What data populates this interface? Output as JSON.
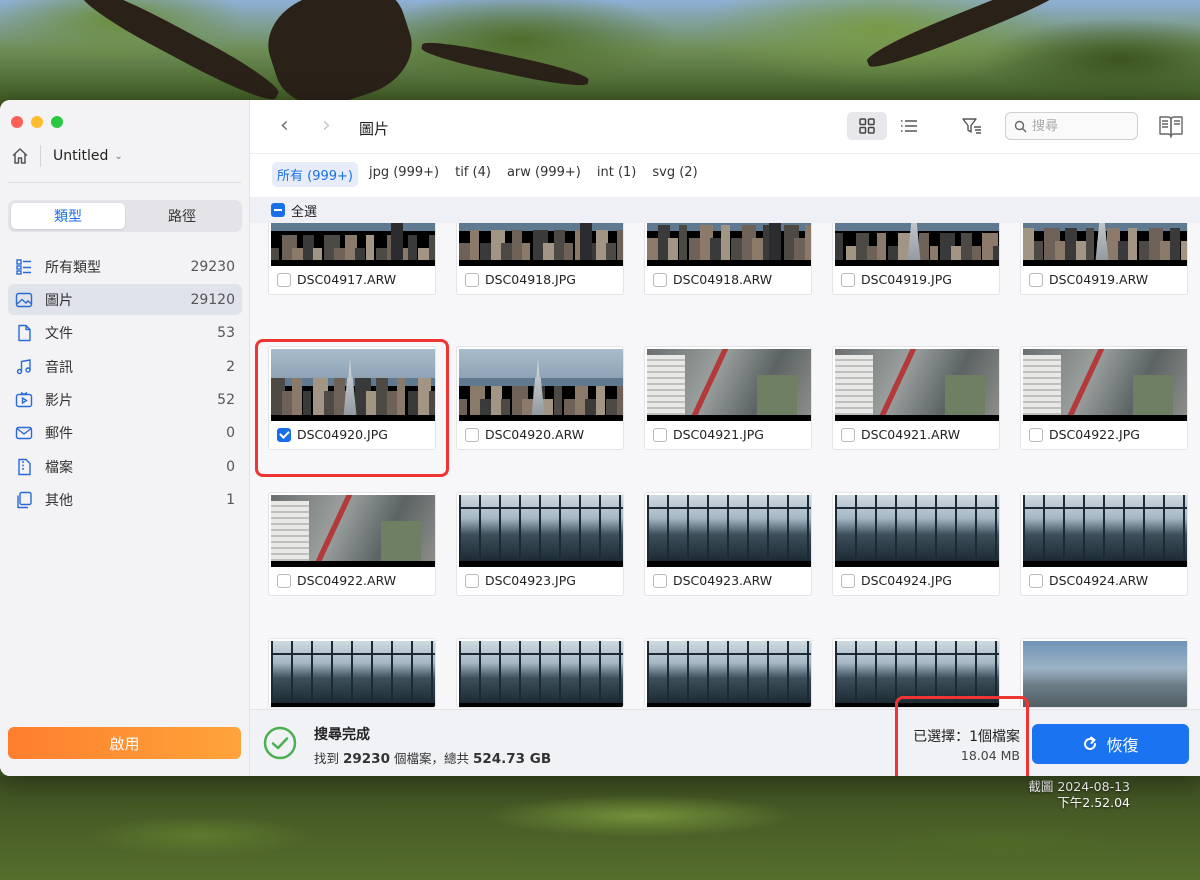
{
  "window": {
    "project_name": "Untitled"
  },
  "sidebar": {
    "tabs": [
      {
        "label": "類型",
        "active": true
      },
      {
        "label": "路徑",
        "active": false
      }
    ],
    "categories": [
      {
        "label": "所有類型",
        "count": "29230",
        "icon": "all-types-icon"
      },
      {
        "label": "圖片",
        "count": "29120",
        "icon": "image-icon",
        "active": true
      },
      {
        "label": "文件",
        "count": "53",
        "icon": "document-icon"
      },
      {
        "label": "音訊",
        "count": "2",
        "icon": "music-icon"
      },
      {
        "label": "影片",
        "count": "52",
        "icon": "video-icon"
      },
      {
        "label": "郵件",
        "count": "0",
        "icon": "mail-icon"
      },
      {
        "label": "檔案",
        "count": "0",
        "icon": "archive-icon"
      },
      {
        "label": "其他",
        "count": "1",
        "icon": "other-icon"
      }
    ],
    "activate_label": "啟用"
  },
  "toolbar": {
    "breadcrumb": "圖片",
    "search_placeholder": "搜尋"
  },
  "filters": [
    {
      "label": "所有 (999+)",
      "active": true
    },
    {
      "label": "jpg (999+)"
    },
    {
      "label": "tif (4)"
    },
    {
      "label": "arw (999+)"
    },
    {
      "label": "int (1)"
    },
    {
      "label": "svg (2)"
    }
  ],
  "select_all_label": "全選",
  "files": [
    "DSC04917.ARW",
    "DSC04918.JPG",
    "DSC04918.ARW",
    "DSC04919.JPG",
    "DSC04919.ARW",
    "DSC04920.JPG",
    "DSC04920.ARW",
    "DSC04921.JPG",
    "DSC04921.ARW",
    "DSC04922.JPG",
    "DSC04922.ARW",
    "DSC04923.JPG",
    "DSC04923.ARW",
    "DSC04924.JPG",
    "DSC04924.ARW"
  ],
  "checked_file": "DSC04920.JPG",
  "status": {
    "title": "搜尋完成",
    "found_prefix": "找到",
    "found_count": "29230",
    "found_mid": "個檔案，總共",
    "total_size": "524.73 GB",
    "selected_text": "已選擇：1個檔案",
    "selected_size": "18.04 MB",
    "recover_label": "恢復"
  },
  "timestamp": {
    "line1": "截圖 2024-08-13",
    "line2": "下午2.52.04"
  },
  "colors": {
    "accent": "#1a6fe8",
    "activate": "#ff8a30",
    "highlight": "#ef3434",
    "success": "#4caf50"
  }
}
